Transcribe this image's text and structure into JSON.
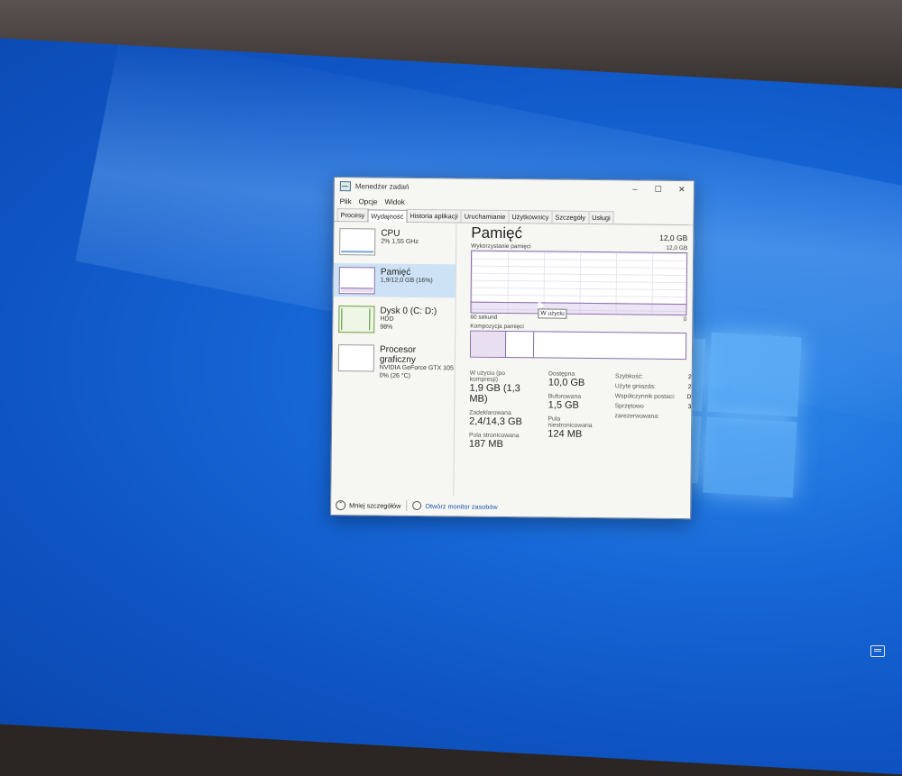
{
  "desktop": {
    "icon_label": "dge"
  },
  "window": {
    "title": "Menedżer zadań",
    "controls": [
      "–",
      "☐",
      "✕"
    ]
  },
  "menu": [
    "Plik",
    "Opcje",
    "Widok"
  ],
  "tabs": [
    "Procesy",
    "Wydajność",
    "Historia aplikacji",
    "Uruchamianie",
    "Użytkownicy",
    "Szczegóły",
    "Usługi"
  ],
  "active_tab": "Wydajność",
  "sidebar": {
    "items": [
      {
        "name": "CPU",
        "line1": "2% 1,55 GHz",
        "line2": ""
      },
      {
        "name": "Pamięć",
        "line1": "1,9/12,0 GB (16%)",
        "line2": ""
      },
      {
        "name": "Dysk 0 (C: D:)",
        "line1": "HDD",
        "line2": "98%"
      },
      {
        "name": "Procesor graficzny",
        "line1": "NVIDIA GeForce GTX 105",
        "line2": "0% (26 °C)"
      }
    ]
  },
  "main": {
    "title": "Pamięć",
    "total": "12,0 GB",
    "usage_label": "Wykorzystanie pamięci",
    "usage_max": "12,0 GB",
    "time_label": "60 sekund",
    "time_end": "0",
    "tooltip": "W użyciu",
    "composition_label": "Kompozycja pamięci",
    "usage_fraction": 0.16,
    "stats": [
      [
        {
          "label": "W użyciu (po kompresji)",
          "value": "1,9 GB (1,3 MB)"
        },
        {
          "label": "Zadeklarowana",
          "value": "2,4/14,3 GB"
        },
        {
          "label": "Pula stronicowana",
          "value": "187 MB"
        }
      ],
      [
        {
          "label": "Dostępna",
          "value": "10,0 GB"
        },
        {
          "label": "Buforowana",
          "value": "1,5 GB"
        },
        {
          "label": "Pula niestronicowana",
          "value": "124 MB"
        }
      ]
    ],
    "right_stats": [
      {
        "label": "Szybkość:",
        "value": "2"
      },
      {
        "label": "Użyte gniazda:",
        "value": "2"
      },
      {
        "label": "Współczynnik postaci:",
        "value": "D"
      },
      {
        "label": "Sprzętowo zarezerwowana:",
        "value": "3"
      }
    ]
  },
  "footer": {
    "less_details": "Mniej szczegółów",
    "resource_monitor": "Otwórz monitor zasobów"
  }
}
